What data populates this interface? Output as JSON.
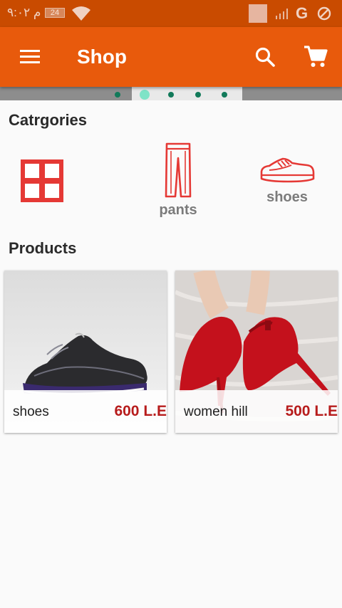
{
  "status_bar": {
    "time": "م ٩:٠٢",
    "battery": "24",
    "network": "G",
    "icons": [
      "wifi-icon",
      "signal-icon",
      "do-not-disturb-icon"
    ]
  },
  "app_bar": {
    "title": "Shop",
    "icons": [
      "menu-icon",
      "search-icon",
      "cart-icon"
    ],
    "color": "#e85a0c"
  },
  "carousel": {
    "dot_count": 5,
    "active_index": 1
  },
  "categories": {
    "title": "Catrgories",
    "items": [
      {
        "label": "",
        "icon": "grid-icon"
      },
      {
        "label": "pants",
        "icon": "pants-icon"
      },
      {
        "label": "shoes",
        "icon": "shoe-icon"
      }
    ],
    "icon_color": "#e53935"
  },
  "products": {
    "title": "Products",
    "items": [
      {
        "name": "shoes",
        "price": "600 L.E"
      },
      {
        "name": "women hill",
        "price": "500 L.E"
      }
    ],
    "price_color": "#b71c1c"
  }
}
